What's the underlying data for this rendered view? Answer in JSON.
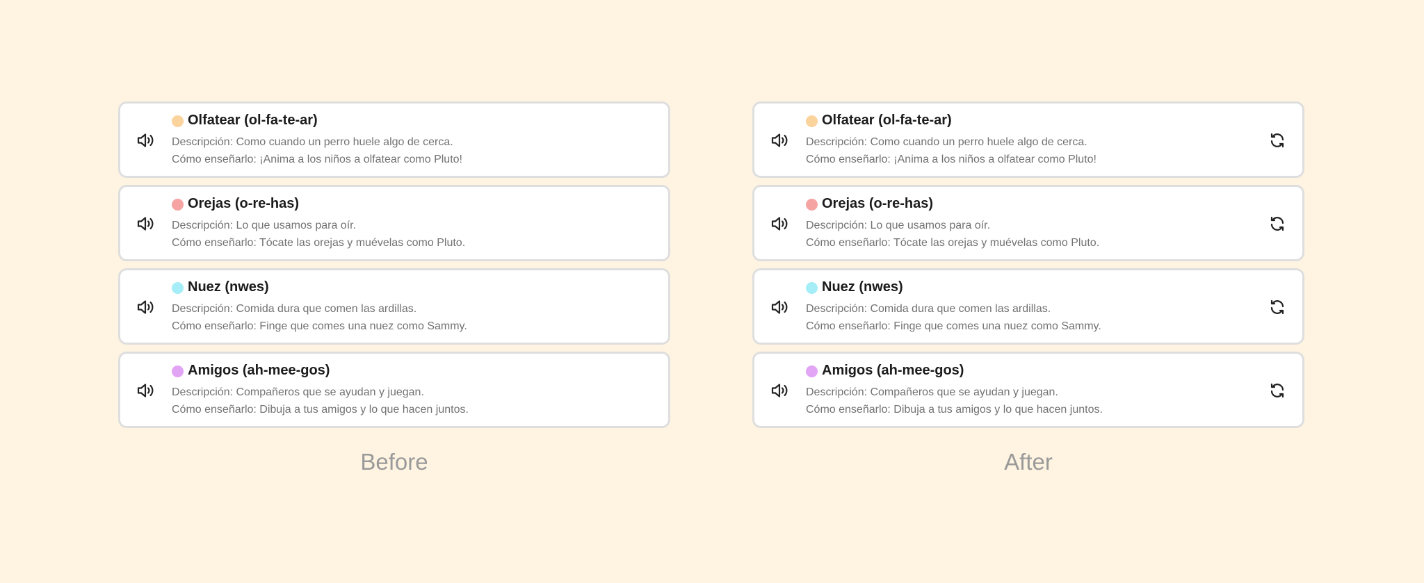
{
  "panels": [
    {
      "caption": "Before",
      "show_refresh": false,
      "cards": [
        {
          "word": "Olfatear (ol-fa-te-ar)",
          "dot_color": "#fbd39d",
          "description": "Descripción: Como cuando un perro huele algo de cerca.",
          "teach": "Cómo enseñarlo: ¡Anima a los niños a olfatear como Pluto!"
        },
        {
          "word": "Orejas (o-re-has)",
          "dot_color": "#f5a3a3",
          "description": "Descripción: Lo que usamos para oír.",
          "teach": "Cómo enseñarlo: Tócate las orejas y muévelas como Pluto."
        },
        {
          "word": "Nuez (nwes)",
          "dot_color": "#a5eef8",
          "description": "Descripción: Comida dura que comen las ardillas.",
          "teach": "Cómo enseñarlo: Finge que comes una nuez como Sammy."
        },
        {
          "word": "Amigos (ah-mee-gos)",
          "dot_color": "#e2a4f4",
          "description": "Descripción: Compañeros que se ayudan y juegan.",
          "teach": "Cómo enseñarlo: Dibuja a tus amigos y lo que hacen juntos."
        }
      ]
    },
    {
      "caption": "After",
      "show_refresh": true,
      "cards": [
        {
          "word": "Olfatear (ol-fa-te-ar)",
          "dot_color": "#fbd39d",
          "description": "Descripción: Como cuando un perro huele algo de cerca.",
          "teach": "Cómo enseñarlo: ¡Anima a los niños a olfatear como Pluto!"
        },
        {
          "word": "Orejas (o-re-has)",
          "dot_color": "#f5a3a3",
          "description": "Descripción: Lo que usamos para oír.",
          "teach": "Cómo enseñarlo: Tócate las orejas y muévelas como Pluto."
        },
        {
          "word": "Nuez (nwes)",
          "dot_color": "#a5eef8",
          "description": "Descripción: Comida dura que comen las ardillas.",
          "teach": "Cómo enseñarlo: Finge que comes una nuez como Sammy."
        },
        {
          "word": "Amigos (ah-mee-gos)",
          "dot_color": "#e2a4f4",
          "description": "Descripción: Compañeros que se ayudan y juegan.",
          "teach": "Cómo enseñarlo: Dibuja a tus amigos y lo que hacen juntos."
        }
      ]
    }
  ],
  "icons": {
    "speaker": "speaker-icon",
    "refresh": "refresh-icon"
  }
}
